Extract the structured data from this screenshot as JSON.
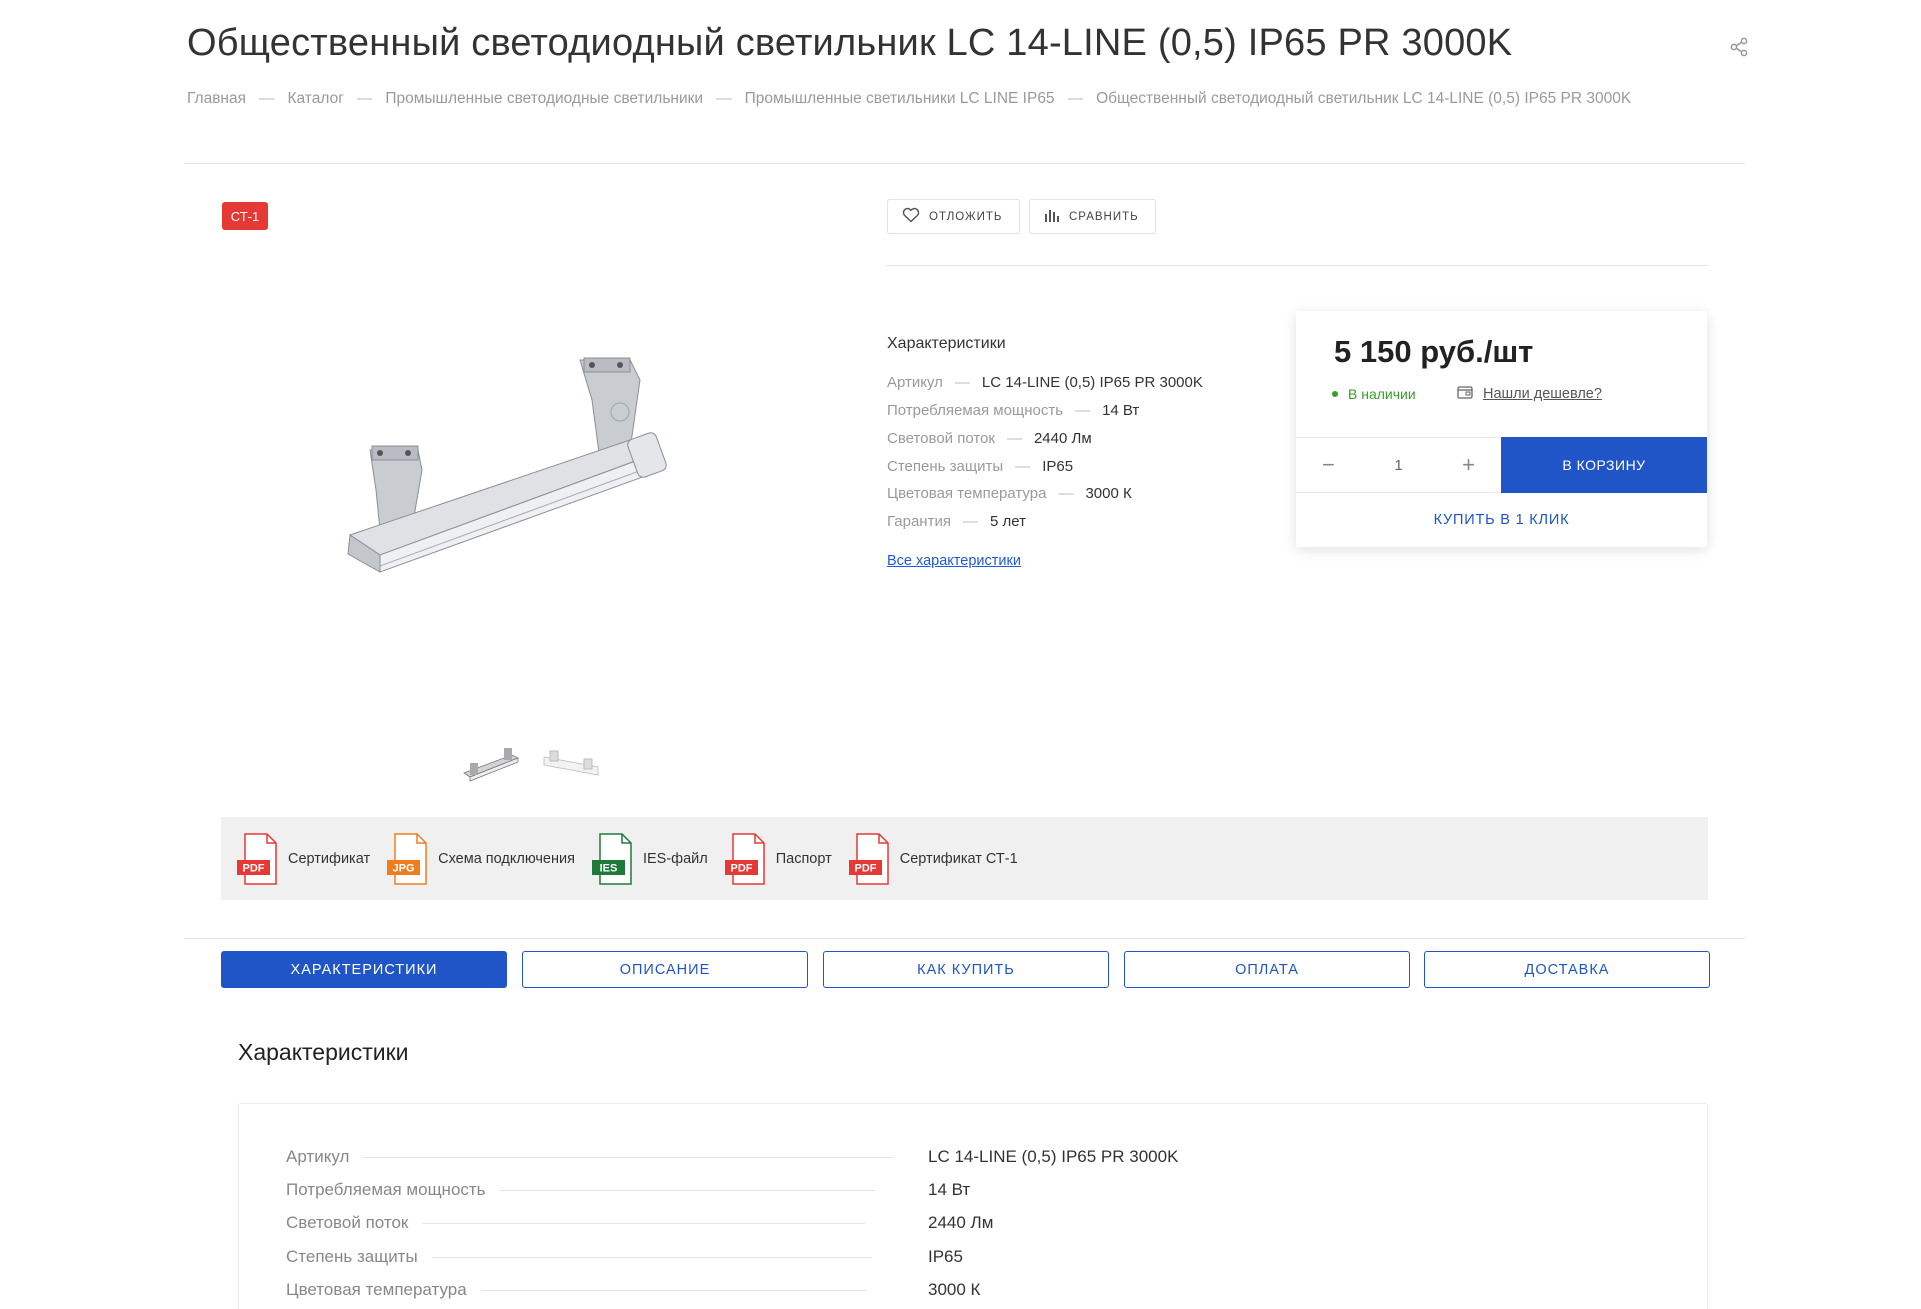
{
  "header": {
    "title": "Общественный светодиодный светильник LC 14-LINE (0,5) IP65 PR 3000K",
    "breadcrumbs": [
      "Главная",
      "Каталог",
      "Промышленные светодиодные светильники",
      "Промышленные светильники LC LINE IP65",
      "Общественный светодиодный светильник LC 14-LINE (0,5) IP65 PR 3000K"
    ],
    "separator": "—"
  },
  "badge": "СТ-1",
  "actions": {
    "defer_label": "ОТЛОЖИТЬ",
    "compare_label": "СРАВНИТЬ"
  },
  "short_specs": {
    "title": "Характеристики",
    "items": [
      {
        "key": "Артикул",
        "value": "LC 14-LINE (0,5) IP65 PR 3000K"
      },
      {
        "key": "Потребляемая мощность",
        "value": "14 Вт"
      },
      {
        "key": "Световой поток",
        "value": "2440 Лм"
      },
      {
        "key": "Степень защиты",
        "value": "IP65"
      },
      {
        "key": "Цветовая температура",
        "value": "3000 К"
      },
      {
        "key": "Гарантия",
        "value": "5 лет"
      }
    ],
    "all_link": "Все характеристики"
  },
  "buy": {
    "price": "5 150 руб./шт",
    "stock": "В наличии",
    "cheaper": "Нашли дешевле?",
    "qty_minus": "−",
    "qty_value": "1",
    "qty_plus": "+",
    "cart_label": "В КОРЗИНУ",
    "oneclick_label": "КУПИТЬ В 1 КЛИК"
  },
  "files": [
    {
      "type": "PDF",
      "label": "Сертификат",
      "color": "#e53935"
    },
    {
      "type": "JPG",
      "label": "Схема подключения",
      "color": "#ef7d1f"
    },
    {
      "type": "IES",
      "label": "IES-файл",
      "color": "#1f7a3a"
    },
    {
      "type": "PDF",
      "label": "Паспорт",
      "color": "#e53935"
    },
    {
      "type": "PDF",
      "label": "Сертификат СТ-1",
      "color": "#e53935"
    }
  ],
  "tabs": [
    "ХАРАКТЕРИСТИКИ",
    "ОПИСАНИЕ",
    "КАК КУПИТЬ",
    "ОПЛАТА",
    "ДОСТАВКА"
  ],
  "specs_section": {
    "title": "Характеристики",
    "rows": [
      {
        "key": "Артикул",
        "value": "LC 14-LINE (0,5) IP65 PR 3000K"
      },
      {
        "key": "Потребляемая мощность",
        "value": "14 Вт"
      },
      {
        "key": "Световой поток",
        "value": "2440 Лм"
      },
      {
        "key": "Степень защиты",
        "value": "IP65"
      },
      {
        "key": "Цветовая температура",
        "value": "3000 К"
      }
    ]
  },
  "colors": {
    "accent": "#1f55c6",
    "badge": "#e53935",
    "in_stock": "#3a9d2a"
  }
}
